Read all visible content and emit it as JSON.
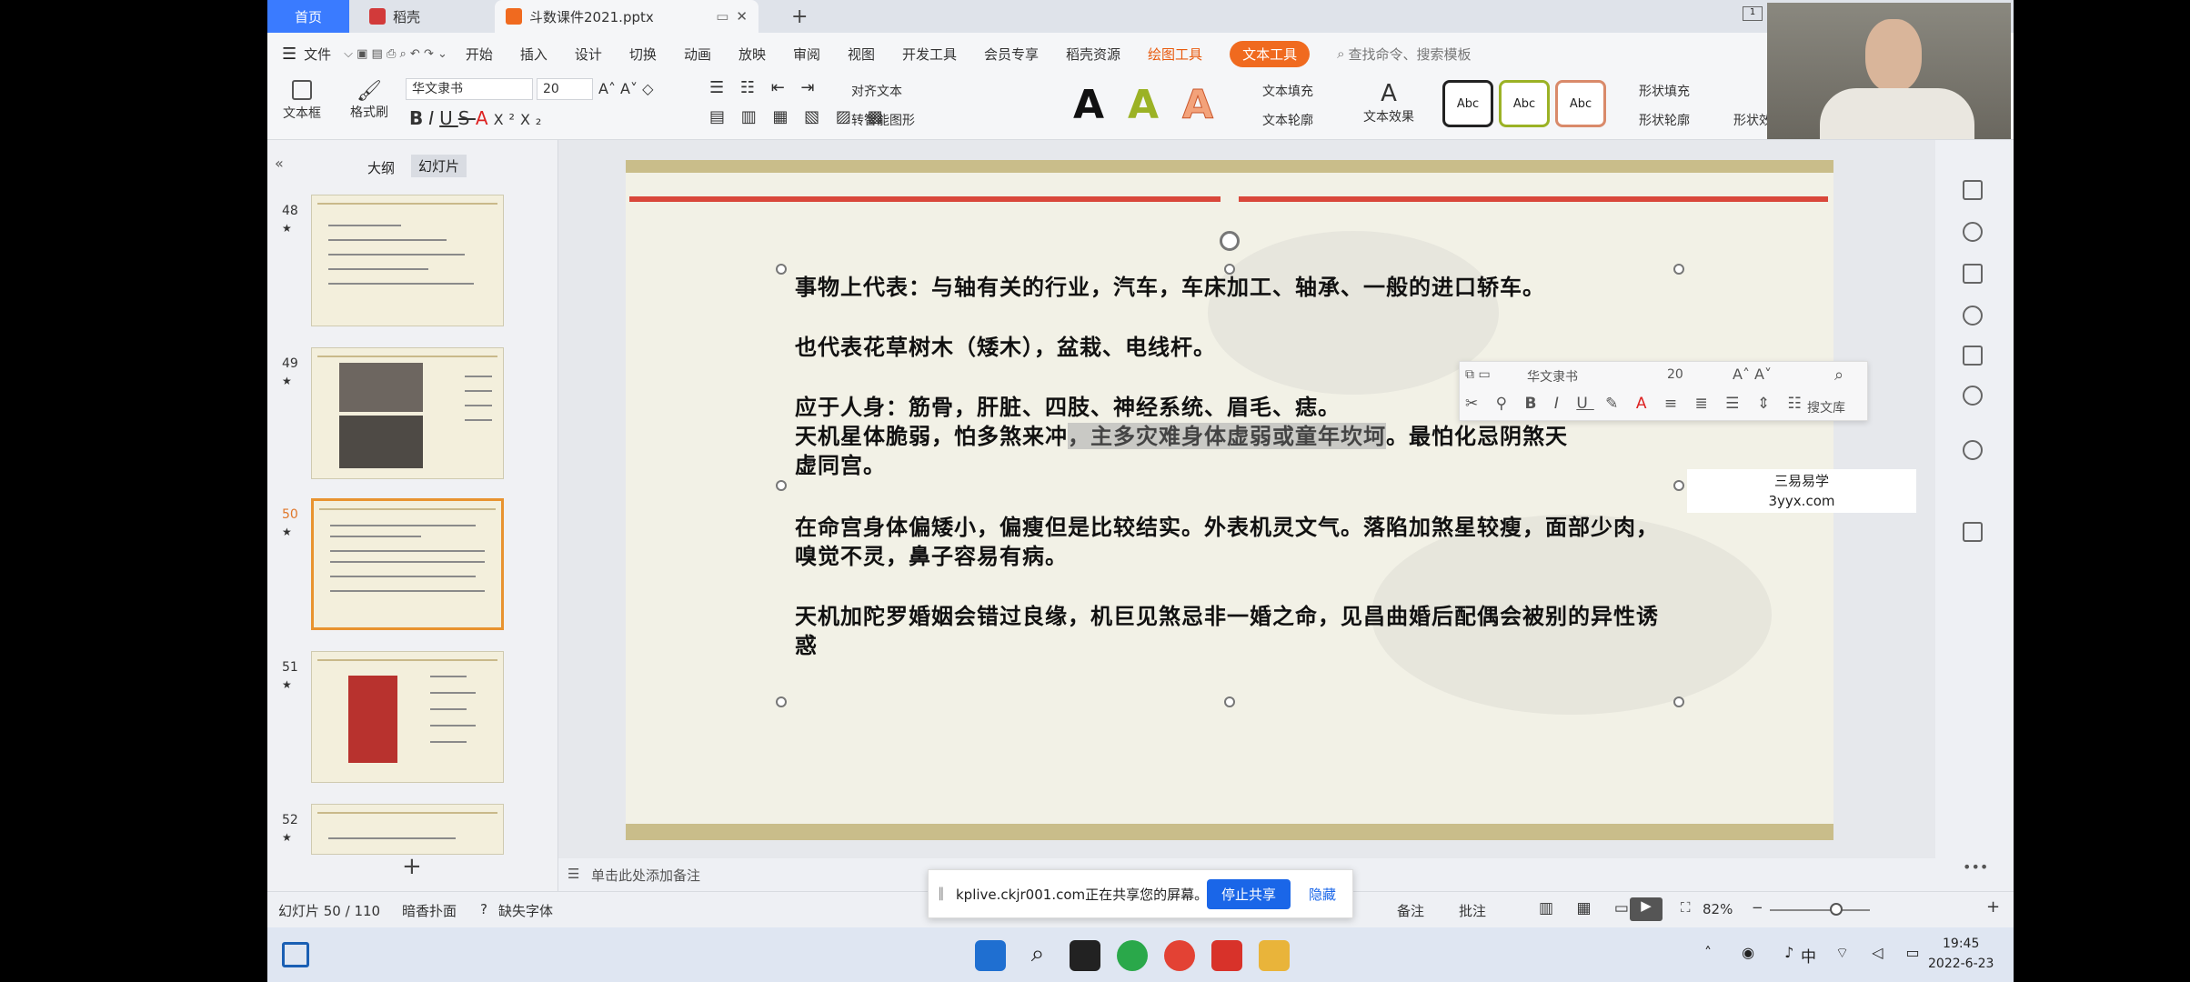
{
  "tabs": {
    "home": "首页",
    "daoke": "稻壳",
    "doc": "斗数课件2021.pptx"
  },
  "menu": {
    "file": "文件",
    "items": [
      "开始",
      "插入",
      "设计",
      "切换",
      "动画",
      "放映",
      "审阅",
      "视图",
      "开发工具",
      "会员专享",
      "稻壳资源"
    ],
    "draw_tools": "绘图工具",
    "text_tools": "文本工具",
    "search": "查找命令、搜索模板"
  },
  "ribbon": {
    "textbox": "文本框",
    "format_painter": "格式刷",
    "font": "华文隶书",
    "size": "20",
    "align_text": "对齐文本",
    "smart_shape": "转智能图形",
    "text_fill": "文本填充",
    "text_outline": "文本轮廓",
    "text_effect": "文本效果",
    "shape_fill": "形状填充",
    "shape_outline": "形状轮廓",
    "shape_effect": "形状效",
    "style_samples": [
      "Abc",
      "Abc",
      "Abc"
    ],
    "big_letters": [
      "A",
      "A",
      "A"
    ],
    "bold": "B",
    "italic": "I",
    "underline": "U",
    "strike": "S",
    "fontcolor": "A",
    "super": "X²",
    "sub": "X₂"
  },
  "panel": {
    "outline": "大纲",
    "slides": "幻灯片",
    "thumbs": [
      {
        "num": "48",
        "star": "★"
      },
      {
        "num": "49",
        "star": "★"
      },
      {
        "num": "50",
        "star": "★"
      },
      {
        "num": "51",
        "star": "★"
      },
      {
        "num": "52",
        "star": "★"
      }
    ],
    "add": "+",
    "collapse": "«"
  },
  "slide": {
    "p1": "事物上代表：与轴有关的行业，汽车，车床加工、轴承、一般的进口轿车。",
    "p2": "也代表花草树木（矮木），盆栽、电线杆。",
    "p3": "应于人身：筋骨，肝脏、四肢、神经系统、眉毛、痣。",
    "p4a": "天机星体脆弱，怕多煞来冲",
    "p4b": "，主多灾难身体虚弱或童年坎坷",
    "p4c": "。最怕化忌阴煞天",
    "p4d": "虚同宫。",
    "p5": "在命宫身体偏矮小，偏瘦但是比较结实。外表机灵文气。落陷加煞星较瘦，面部少肉，嗅觉不灵，鼻子容易有病。",
    "p6": "天机加陀罗婚姻会错过良缘，机巨见煞忌非一婚之命，见昌曲婚后配偶会被别的异性诱惑"
  },
  "minibar": {
    "font": "华文隶书",
    "size": "20",
    "more": "搜文库"
  },
  "notes": "单击此处添加备注",
  "status": {
    "slide_count": "幻灯片 50 / 110",
    "theme": "暗香扑面",
    "missing_font": "缺失字体",
    "notes": "备注",
    "comment": "批注",
    "zoom": "82%"
  },
  "share": {
    "text": "kplive.ckjr001.com正在共享您的屏幕。",
    "stop": "停止共享",
    "hide": "隐藏"
  },
  "taskbar": {
    "time": "19:45",
    "date": "2022-6-23",
    "ime": "中"
  },
  "watermark": {
    "line1": "三易易学",
    "line2": "3yyx.com"
  },
  "colors": {
    "accent_blue": "#3a7bff",
    "text_tool_orange": "#f06a1f",
    "slide_red": "#d9473a",
    "slide_gold": "#c9bd8a"
  }
}
